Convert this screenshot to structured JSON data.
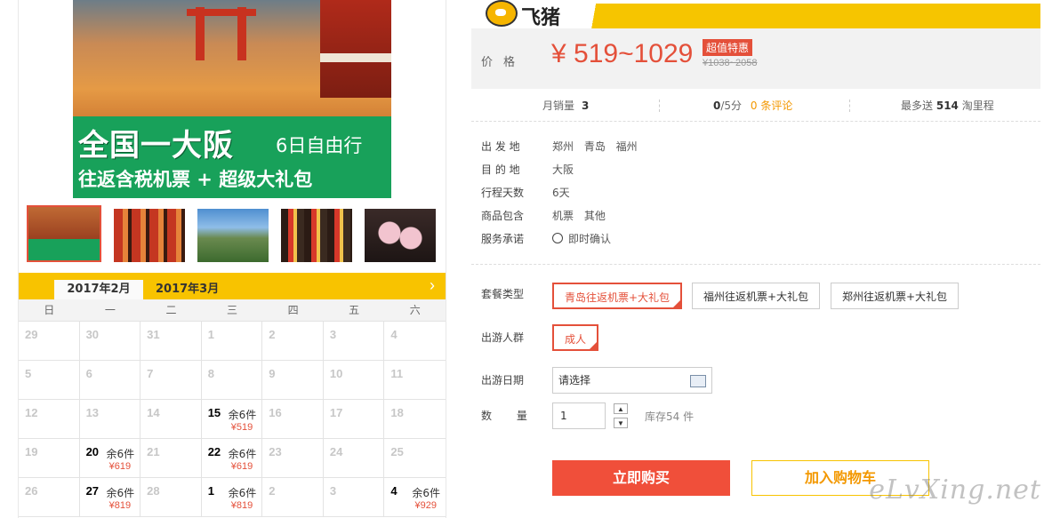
{
  "hero": {
    "title_big": "全国一大阪",
    "title_sub": "6日自由行",
    "title_bottom": "往返含税机票 + 超级大礼包"
  },
  "thumbnails": [
    "thumb-1",
    "thumb-2",
    "thumb-3",
    "thumb-4",
    "thumb-5"
  ],
  "calendar": {
    "tab_active": "2017年2月",
    "tab_next": "2017年3月",
    "next_icon": "chevron-right-icon",
    "weekdays": [
      "日",
      "一",
      "二",
      "三",
      "四",
      "五",
      "六"
    ],
    "cells": [
      {
        "d": "29"
      },
      {
        "d": "30"
      },
      {
        "d": "31"
      },
      {
        "d": "1"
      },
      {
        "d": "2"
      },
      {
        "d": "3"
      },
      {
        "d": "4"
      },
      {
        "d": "5"
      },
      {
        "d": "6"
      },
      {
        "d": "7"
      },
      {
        "d": "8"
      },
      {
        "d": "9"
      },
      {
        "d": "10"
      },
      {
        "d": "11"
      },
      {
        "d": "12"
      },
      {
        "d": "13"
      },
      {
        "d": "14"
      },
      {
        "d": "15",
        "stock": "余6件",
        "price": "¥519",
        "on": true
      },
      {
        "d": "16"
      },
      {
        "d": "17"
      },
      {
        "d": "18"
      },
      {
        "d": "19"
      },
      {
        "d": "20",
        "stock": "余6件",
        "price": "¥619",
        "on": true
      },
      {
        "d": "21"
      },
      {
        "d": "22",
        "stock": "余6件",
        "price": "¥619",
        "on": true
      },
      {
        "d": "23"
      },
      {
        "d": "24"
      },
      {
        "d": "25"
      },
      {
        "d": "26"
      },
      {
        "d": "27",
        "stock": "余6件",
        "price": "¥819",
        "on": true
      },
      {
        "d": "28"
      },
      {
        "d": "1",
        "stock": "余6件",
        "price": "¥819",
        "on": true
      },
      {
        "d": "2"
      },
      {
        "d": "3"
      },
      {
        "d": "4",
        "stock": "余6件",
        "price": "¥929",
        "on": true
      }
    ]
  },
  "brand": {
    "name": "飞猪"
  },
  "price": {
    "label": "价格",
    "main": "¥ 519~1029",
    "tag": "超值特惠",
    "old": "¥1038~2058"
  },
  "stats": {
    "monthly_label": "月销量",
    "monthly_value": "3",
    "rating_value": "0",
    "rating_suffix": "/5分",
    "reviews": "0 条评论",
    "miles_prefix": "最多送",
    "miles_value": "514",
    "miles_suffix": "淘里程"
  },
  "info": [
    {
      "k": "出 发 地",
      "v": "郑州  青岛  福州"
    },
    {
      "k": "目 的 地",
      "v": "大阪"
    },
    {
      "k": "行程天数",
      "v": "6天"
    },
    {
      "k": "商品包含",
      "v": "机票  其他"
    },
    {
      "k": "服务承诺",
      "v": "即时确认"
    }
  ],
  "options": {
    "package_label": "套餐类型",
    "packages": [
      "青岛往返机票+大礼包",
      "福州往返机票+大礼包",
      "郑州往返机票+大礼包"
    ],
    "crowd_label": "出游人群",
    "crowd": "成人",
    "date_label": "出游日期",
    "date_placeholder": "请选择",
    "qty_label": "数 量",
    "qty_value": "1",
    "stock": "库存54 件"
  },
  "actions": {
    "buy": "立即购买",
    "cart": "加入购物车"
  },
  "watermark": "eLvXing.net",
  "colors": {
    "accent": "#e4503a",
    "brand_yellow": "#f8c300",
    "orange_text": "#f39800"
  }
}
